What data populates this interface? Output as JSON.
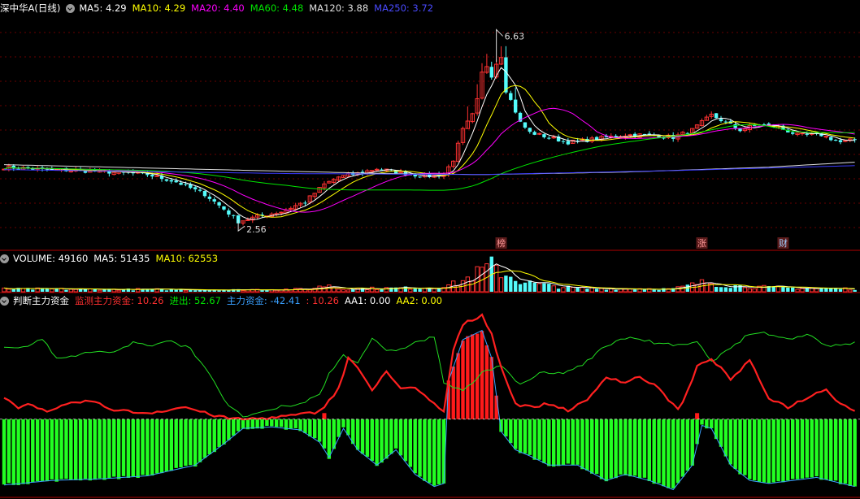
{
  "colors": {
    "up": "#ff3232",
    "down": "#54fcfc",
    "ma5": "#ffffff",
    "ma10": "#ffff00",
    "ma20": "#ff00ff",
    "ma60": "#00e600",
    "ma120": "#e0e0e0",
    "ma250": "#3a3aff",
    "divider": "#b00000",
    "grid": "#6a0000",
    "aa1": "#ffffff",
    "aa2": "#ffff00"
  },
  "price_header": {
    "stock_name": "深中华A(日线)",
    "ma5": "MA5: 4.29",
    "ma10": "MA10: 4.29",
    "ma20": "MA20: 4.40",
    "ma60": "MA60: 4.48",
    "ma120": "MA120: 3.88",
    "ma250": "MA250: 3.72"
  },
  "volume_header": {
    "volume": "VOLUME: 49160",
    "ma5": "MA5: 51435",
    "ma10": "MA10: 62553"
  },
  "indicator_header": {
    "name": "判断主力资金",
    "monitor": "监测主力资金: 10.26",
    "inout": "进出: 52.67",
    "main_fund": "主力资金: -42.41",
    "extra": ": 10.26",
    "aa1": "AA1: 0.00",
    "aa2": "AA2: 0.00"
  },
  "markers": [
    {
      "label": "榜",
      "index": 104
    },
    {
      "label": "涨",
      "index": 146
    },
    {
      "label": "财",
      "index": 163
    }
  ],
  "chart_data": [
    {
      "type": "candlestick",
      "title": "深中华A(日线)",
      "ylim": [
        2.3,
        6.9
      ],
      "high_annotation": {
        "label": "6.63",
        "value": 6.63,
        "index": 103
      },
      "low_annotation": {
        "label": "2.56",
        "value": 2.56,
        "index": 49
      },
      "series": [
        "MA5",
        "MA10",
        "MA20",
        "MA60",
        "MA120",
        "MA250"
      ],
      "anchors": [
        [
          0,
          3.85
        ],
        [
          8,
          3.8
        ],
        [
          15,
          3.78
        ],
        [
          22,
          3.75
        ],
        [
          30,
          3.7
        ],
        [
          36,
          3.55
        ],
        [
          42,
          3.3
        ],
        [
          46,
          3.0
        ],
        [
          49,
          2.75
        ],
        [
          53,
          2.85
        ],
        [
          58,
          2.95
        ],
        [
          63,
          3.15
        ],
        [
          67,
          3.5
        ],
        [
          70,
          3.65
        ],
        [
          74,
          3.72
        ],
        [
          78,
          3.82
        ],
        [
          84,
          3.72
        ],
        [
          88,
          3.66
        ],
        [
          92,
          3.7
        ],
        [
          94,
          4.0
        ],
        [
          96,
          4.6
        ],
        [
          98,
          4.9
        ],
        [
          100,
          5.5
        ],
        [
          102,
          5.7
        ],
        [
          104,
          5.6
        ],
        [
          106,
          5.2
        ],
        [
          108,
          4.75
        ],
        [
          110,
          4.55
        ],
        [
          114,
          4.45
        ],
        [
          118,
          4.35
        ],
        [
          124,
          4.42
        ],
        [
          130,
          4.5
        ],
        [
          136,
          4.5
        ],
        [
          140,
          4.45
        ],
        [
          144,
          4.6
        ],
        [
          148,
          4.9
        ],
        [
          151,
          4.75
        ],
        [
          154,
          4.6
        ],
        [
          158,
          4.72
        ],
        [
          162,
          4.65
        ],
        [
          166,
          4.5
        ],
        [
          171,
          4.5
        ],
        [
          175,
          4.35
        ],
        [
          178,
          4.4
        ]
      ],
      "spikes": [
        [
          100,
          5.75
        ],
        [
          101,
          5.9
        ],
        [
          103,
          5.95
        ],
        [
          104,
          6.1
        ]
      ],
      "ma120_anchors": [
        [
          0,
          3.9
        ],
        [
          80,
          3.72
        ],
        [
          100,
          3.7
        ],
        [
          130,
          3.75
        ],
        [
          160,
          3.85
        ],
        [
          178,
          3.95
        ]
      ],
      "ma250_anchors": [
        [
          0,
          3.8
        ],
        [
          60,
          3.72
        ],
        [
          100,
          3.7
        ],
        [
          140,
          3.78
        ],
        [
          178,
          3.88
        ]
      ],
      "n_bars": 179
    },
    {
      "type": "bar",
      "title": "VOLUME",
      "ylim": [
        0,
        100000
      ],
      "series": [
        "VOLUME",
        "MA5",
        "MA10"
      ],
      "anchors": [
        [
          0,
          10000
        ],
        [
          30,
          8000
        ],
        [
          50,
          7000
        ],
        [
          64,
          9000
        ],
        [
          68,
          25000
        ],
        [
          70,
          10000
        ],
        [
          90,
          15000
        ],
        [
          95,
          30000
        ],
        [
          98,
          55000
        ],
        [
          100,
          75000
        ],
        [
          102,
          90000
        ],
        [
          104,
          70000
        ],
        [
          106,
          55000
        ],
        [
          108,
          38000
        ],
        [
          112,
          25000
        ],
        [
          120,
          12000
        ],
        [
          140,
          10000
        ],
        [
          147,
          35000
        ],
        [
          150,
          25000
        ],
        [
          154,
          20000
        ],
        [
          160,
          15000
        ],
        [
          178,
          10000
        ]
      ]
    },
    {
      "type": "bar",
      "title": "判断主力资金",
      "ylim": [
        -50,
        70
      ],
      "series": [
        "监测主力资金",
        "进出",
        "主力资金",
        "AA1",
        "AA2"
      ],
      "red_line": [
        [
          0,
          14
        ],
        [
          3,
          8
        ],
        [
          6,
          10
        ],
        [
          9,
          4
        ],
        [
          12,
          8
        ],
        [
          15,
          11
        ],
        [
          18,
          12
        ],
        [
          22,
          7
        ],
        [
          26,
          5
        ],
        [
          30,
          4
        ],
        [
          34,
          6
        ],
        [
          38,
          8
        ],
        [
          42,
          4
        ],
        [
          46,
          1
        ],
        [
          50,
          0
        ],
        [
          56,
          1
        ],
        [
          62,
          3
        ],
        [
          66,
          5
        ],
        [
          70,
          20
        ],
        [
          72,
          40
        ],
        [
          74,
          34
        ],
        [
          77,
          18
        ],
        [
          80,
          32
        ],
        [
          83,
          20
        ],
        [
          86,
          20
        ],
        [
          90,
          10
        ],
        [
          92,
          5
        ],
        [
          94,
          45
        ],
        [
          96,
          62
        ],
        [
          100,
          68
        ],
        [
          102,
          56
        ],
        [
          104,
          34
        ],
        [
          107,
          10
        ],
        [
          110,
          8
        ],
        [
          114,
          10
        ],
        [
          118,
          6
        ],
        [
          122,
          12
        ],
        [
          126,
          28
        ],
        [
          130,
          24
        ],
        [
          133,
          28
        ],
        [
          137,
          20
        ],
        [
          141,
          6
        ],
        [
          143,
          18
        ],
        [
          145,
          34
        ],
        [
          148,
          40
        ],
        [
          152,
          26
        ],
        [
          156,
          38
        ],
        [
          160,
          14
        ],
        [
          164,
          8
        ],
        [
          168,
          14
        ],
        [
          172,
          20
        ],
        [
          175,
          10
        ],
        [
          178,
          6
        ]
      ],
      "green_line": [
        [
          0,
          48
        ],
        [
          4,
          47
        ],
        [
          8,
          52
        ],
        [
          11,
          40
        ],
        [
          15,
          42
        ],
        [
          19,
          44
        ],
        [
          23,
          44
        ],
        [
          27,
          50
        ],
        [
          31,
          48
        ],
        [
          35,
          51
        ],
        [
          39,
          46
        ],
        [
          43,
          30
        ],
        [
          47,
          8
        ],
        [
          50,
          2
        ],
        [
          54,
          4
        ],
        [
          58,
          8
        ],
        [
          62,
          10
        ],
        [
          66,
          16
        ],
        [
          68,
          30
        ],
        [
          71,
          42
        ],
        [
          74,
          37
        ],
        [
          77,
          53
        ],
        [
          80,
          44
        ],
        [
          83,
          46
        ],
        [
          86,
          50
        ],
        [
          90,
          54
        ],
        [
          92,
          24
        ],
        [
          96,
          18
        ],
        [
          100,
          30
        ],
        [
          104,
          36
        ],
        [
          108,
          22
        ],
        [
          112,
          30
        ],
        [
          117,
          30
        ],
        [
          121,
          36
        ],
        [
          126,
          48
        ],
        [
          131,
          54
        ],
        [
          136,
          50
        ],
        [
          141,
          48
        ],
        [
          145,
          50
        ],
        [
          148,
          38
        ],
        [
          152,
          46
        ],
        [
          156,
          56
        ],
        [
          160,
          56
        ],
        [
          164,
          52
        ],
        [
          168,
          56
        ],
        [
          172,
          48
        ],
        [
          178,
          50
        ]
      ],
      "hist": [
        [
          0,
          -43
        ],
        [
          10,
          -40
        ],
        [
          20,
          -39
        ],
        [
          30,
          -37
        ],
        [
          40,
          -30
        ],
        [
          46,
          -16
        ],
        [
          50,
          -6
        ],
        [
          56,
          -5
        ],
        [
          62,
          -7
        ],
        [
          66,
          -15
        ],
        [
          68,
          -25
        ],
        [
          71,
          -6
        ],
        [
          74,
          -20
        ],
        [
          78,
          -30
        ],
        [
          82,
          -20
        ],
        [
          86,
          -36
        ],
        [
          90,
          -44
        ],
        [
          92,
          -42
        ],
        [
          93,
          25
        ],
        [
          96,
          52
        ],
        [
          100,
          58
        ],
        [
          102,
          40
        ],
        [
          104,
          -8
        ],
        [
          107,
          -20
        ],
        [
          110,
          -24
        ],
        [
          114,
          -30
        ],
        [
          120,
          -30
        ],
        [
          126,
          -40
        ],
        [
          130,
          -36
        ],
        [
          135,
          -40
        ],
        [
          140,
          -46
        ],
        [
          144,
          -30
        ],
        [
          146,
          -4
        ],
        [
          148,
          -6
        ],
        [
          152,
          -30
        ],
        [
          156,
          -40
        ],
        [
          160,
          -42
        ],
        [
          170,
          -38
        ],
        [
          178,
          -44
        ]
      ],
      "red_spikes": [
        [
          67,
          4
        ],
        [
          145,
          4
        ]
      ]
    }
  ]
}
